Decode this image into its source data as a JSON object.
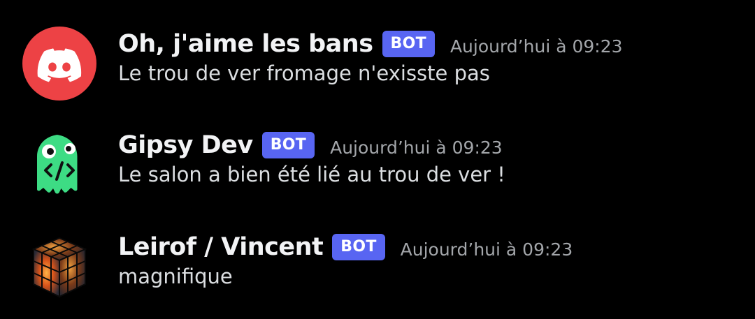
{
  "messages": [
    {
      "username": "Oh, j'aime les bans",
      "tag": "BOT",
      "timestamp": "Aujourd’hui à 09:23",
      "content": "Le trou de ver fromage n'exisste pas",
      "avatar": {
        "icon": "discord-logo-icon",
        "bg": "#ed4245"
      }
    },
    {
      "username": "Gipsy Dev",
      "tag": "BOT",
      "timestamp": "Aujourd’hui à 09:23",
      "content": "Le salon a bien été lié au trou de ver !",
      "avatar": {
        "icon": "ghost-code-icon",
        "bg": "#000000",
        "color": "#3ddc84"
      }
    },
    {
      "username": "Leirof / Vincent",
      "tag": "BOT",
      "timestamp": "Aujourd’hui à 09:23",
      "content": "magnifique",
      "avatar": {
        "icon": "fire-cube-icon",
        "bg": "#000000"
      }
    }
  ],
  "colors": {
    "background": "#000000",
    "bot_tag": "#5865f2",
    "username": "#f2f3f5",
    "timestamp": "#a3a6aa",
    "content": "#dbdee1"
  }
}
